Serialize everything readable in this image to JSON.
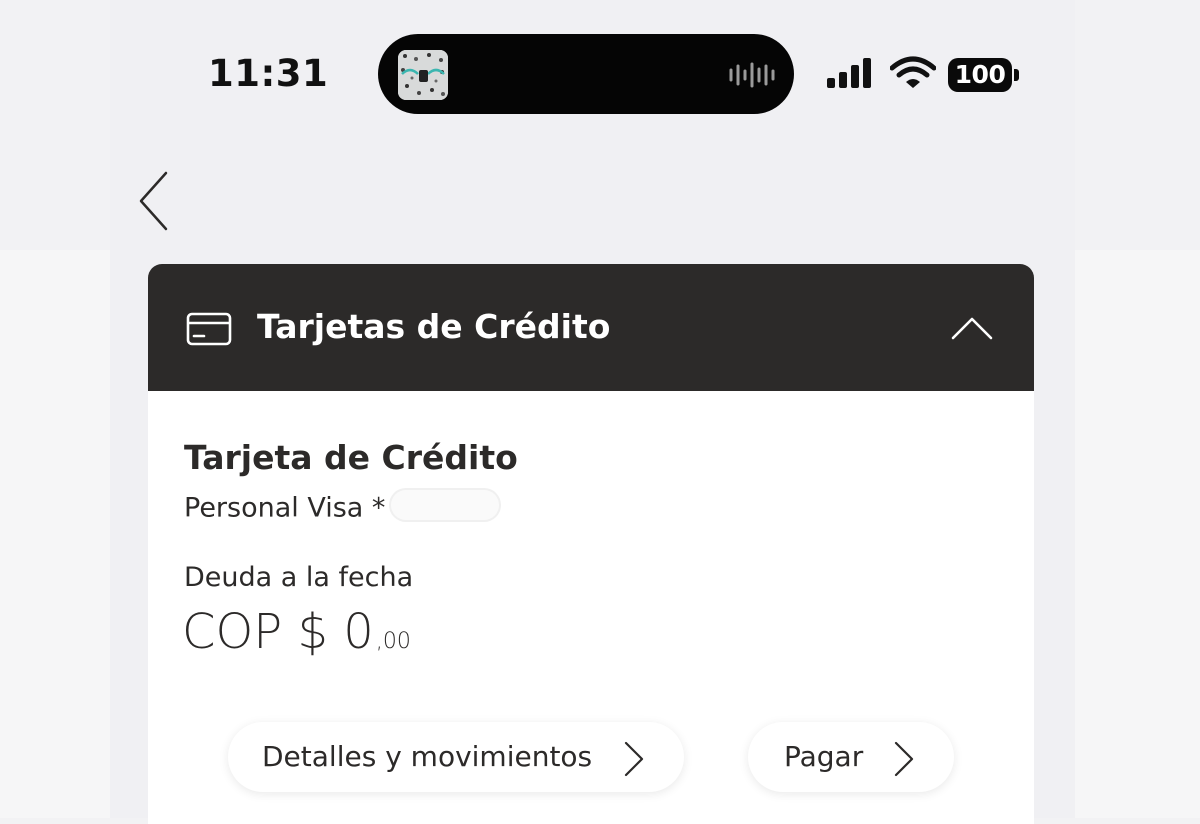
{
  "status_bar": {
    "time": "11:31",
    "battery": "100"
  },
  "header": {
    "back_icon": "chevron-left-icon"
  },
  "section": {
    "title": "Tarjetas de Crédito",
    "icon": "credit-card-icon",
    "collapse_icon": "chevron-up-icon",
    "header_bg": "#2c2a29"
  },
  "product": {
    "title": "Tarjeta de Crédito",
    "subtitle": "Personal Visa *",
    "debt_label": "Deuda a la fecha",
    "debt_amount": "COP $ 0",
    "debt_cents": ",00"
  },
  "actions": {
    "details_label": "Detalles y movimientos",
    "pay_label": "Pagar"
  }
}
